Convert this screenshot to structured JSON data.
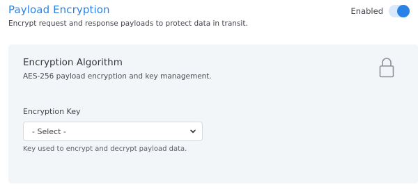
{
  "header": {
    "title": "Payload Encryption",
    "description": "Encrypt request and response payloads to protect data in transit.",
    "toggle_label": "Enabled",
    "toggle_on": true
  },
  "card": {
    "title": "Encryption Algorithm",
    "description": "AES-256 payload encryption and key management.",
    "icon": "lock-icon",
    "field": {
      "label": "Encryption Key",
      "selected": "- Select -",
      "help": "Key used to encrypt and decrypt payload data."
    }
  },
  "colors": {
    "accent": "#2a82e6",
    "card_bg": "#f3f6f9",
    "toggle_track": "#d8e9fb"
  }
}
